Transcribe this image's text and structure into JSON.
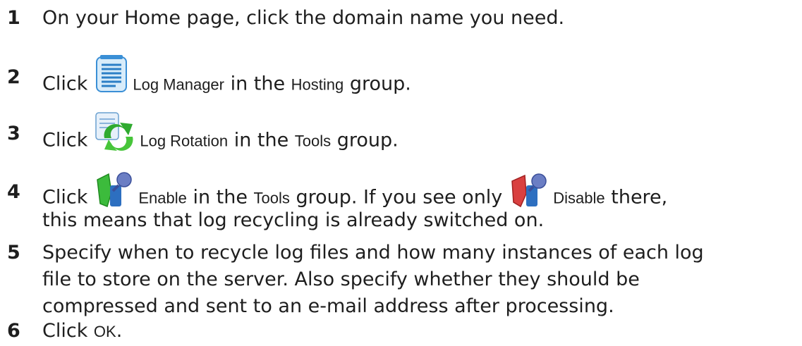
{
  "steps": [
    {
      "num": "1",
      "text": "On your Home page, click the domain name you need."
    },
    {
      "num": "2",
      "pre": "Click",
      "icon": "log-manager-icon",
      "term": "Log Manager",
      "post": " in the ",
      "group": "Hosting",
      "end": " group."
    },
    {
      "num": "3",
      "pre": "Click",
      "icon": "log-rotation-icon",
      "term": "Log Rotation",
      "post": " in the ",
      "group": "Tools",
      "end": " group."
    },
    {
      "num": "4",
      "pre": "Click",
      "icon": "enable-icon",
      "term": "Enable",
      "post": " in the ",
      "group": "Tools",
      "mid": " group. If you see only",
      "icon2": "disable-icon",
      "term2": "Disable",
      "end": " there,",
      "line2": "this means that log recycling is already switched on."
    },
    {
      "num": "5",
      "lines": [
        "Specify when to recycle log files and how many instances of each log",
        "file to store on the server. Also specify whether they should be",
        "compressed and sent to an e-mail address after processing."
      ]
    },
    {
      "num": "6",
      "pre": "Click ",
      "term": "OK",
      "end": "."
    }
  ]
}
